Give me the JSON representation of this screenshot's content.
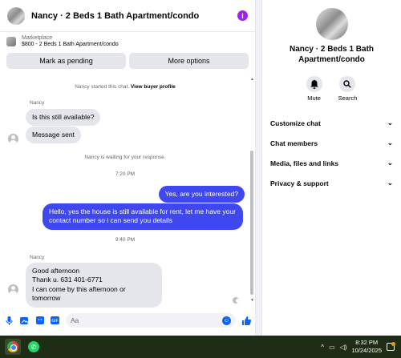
{
  "chat": {
    "title": "Nancy · 2 Beds 1 Bath Apartment/condo",
    "info_icon": "i",
    "listing": {
      "label": "Marketplace",
      "detail": "$800 - 2 Beds 1 Bath Apartment/condo"
    },
    "mark_pending_label": "Mark as pending",
    "more_options_label": "More options"
  },
  "thread": {
    "started": "Nancy started this chat.",
    "view_profile": "View buyer profile",
    "sender_1": "Nancy",
    "msg_1": "Is this still available?",
    "msg_2": "Message sent",
    "waiting": "Nancy is waiting for your response.",
    "time_1": "7:20 PM",
    "out_1": "Yes, are you interested?",
    "out_2": "Hello, yes the house is still available for rent, let me have your contact number so i can send you details",
    "time_2": "9:40 PM",
    "sender_2": "Nancy",
    "in_3_line1": "Good afternoon",
    "in_3_line2": "Thank u. 631 401-6771",
    "in_3_line3": "I can come by this afternoon or tomorrow"
  },
  "composer": {
    "placeholder": "Aa",
    "icons": [
      "microphone-icon",
      "photo-icon",
      "sticker-icon",
      "gif-icon",
      "emoji-icon",
      "thumbs-up-icon"
    ]
  },
  "info": {
    "title": "Nancy · 2 Beds 1 Bath Apartment/condo",
    "mute_label": "Mute",
    "search_label": "Search",
    "sections": [
      "Customize chat",
      "Chat members",
      "Media, files and links",
      "Privacy & support"
    ]
  },
  "taskbar": {
    "time": "8:32 PM",
    "date": "10/24/2025"
  },
  "colors": {
    "accent": "#3f47ee",
    "messenger_blue": "#0866ff",
    "info_purple": "#a020f0",
    "taskbar": "#1f2d16"
  }
}
